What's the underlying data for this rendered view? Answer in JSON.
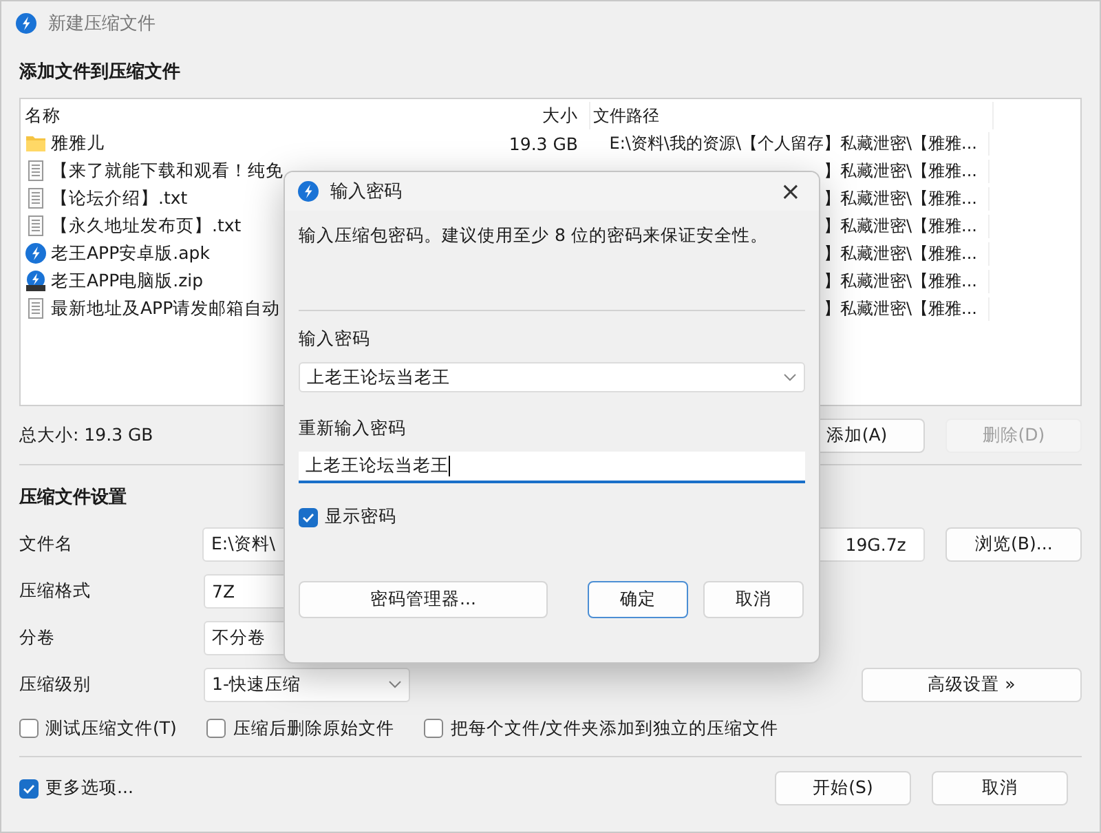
{
  "window": {
    "title": "新建压缩文件"
  },
  "heading": "添加文件到压缩文件",
  "file_list": {
    "columns": [
      "名称",
      "大小",
      "文件路径"
    ],
    "rows": [
      {
        "kind": "folder",
        "name": "雅雅儿",
        "size": "19.3 GB",
        "path": "E:\\资料\\我的资源\\【个人留存】私藏泄密\\【雅雅..."
      },
      {
        "kind": "text",
        "name": "【来了就能下载和观看！纯免",
        "path": "】私藏泄密\\【雅雅..."
      },
      {
        "kind": "text",
        "name": "【论坛介绍】.txt",
        "path": "】私藏泄密\\【雅雅..."
      },
      {
        "kind": "text",
        "name": "【永久地址发布页】.txt",
        "path": "】私藏泄密\\【雅雅..."
      },
      {
        "kind": "apk",
        "name": "老王APP安卓版.apk",
        "path": "】私藏泄密\\【雅雅..."
      },
      {
        "kind": "zip",
        "name": "老王APP电脑版.zip",
        "path": "】私藏泄密\\【雅雅..."
      },
      {
        "kind": "text",
        "name": "最新地址及APP请发邮箱自动",
        "path": "】私藏泄密\\【雅雅..."
      }
    ]
  },
  "total_size": "总大小: 19.3 GB",
  "list_buttons": [
    {
      "label": "添加(A)",
      "disabled": false
    },
    {
      "label": "删除(D)",
      "disabled": true
    }
  ],
  "settings": {
    "title": "压缩文件设置",
    "file_name": {
      "label": "文件名",
      "value": "E:\\资料\\",
      "value_end": "19G.7z",
      "browse": "浏览(B)..."
    },
    "format": {
      "label": "压缩格式",
      "value": "7Z"
    },
    "split": {
      "label": "分卷",
      "value": "不分卷"
    },
    "level": {
      "label": "压缩级别",
      "value": "1-快速压缩"
    },
    "advanced": "高级设置 »",
    "options": [
      {
        "label": "测试压缩文件(T)",
        "checked": false
      },
      {
        "label": "压缩后删除原始文件",
        "checked": false
      },
      {
        "label": "把每个文件/文件夹添加到独立的压缩文件",
        "checked": false
      }
    ]
  },
  "more_options": {
    "label": "更多选项...",
    "checked": true
  },
  "buttons": [
    "开始(S)",
    "取消"
  ],
  "password_dialog": {
    "title": "输入密码",
    "close": "×",
    "description": "输入压缩包密码。建议使用至少 8 位的密码来保证安全性。",
    "password_label": "输入密码",
    "password": "上老王论坛当老王",
    "confirm_label": "重新输入密码",
    "confirm": "上老王论坛当老王",
    "show_password": {
      "label": "显示密码",
      "checked": true
    },
    "buttons": [
      {
        "label": "密码管理器...",
        "default": false
      },
      {
        "label": "确定",
        "default": true
      },
      {
        "label": "取消",
        "default": false
      }
    ]
  }
}
